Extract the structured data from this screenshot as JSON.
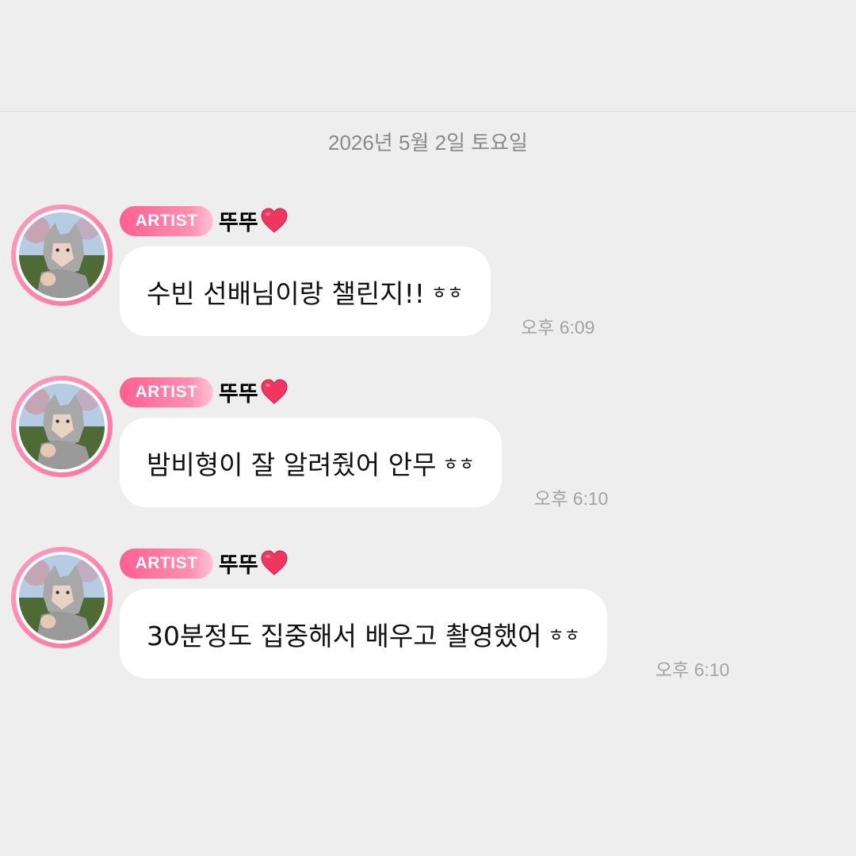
{
  "date_divider": "2026년 5월 2일 토요일",
  "messages": [
    {
      "badge": "ARTIST",
      "sender": "뚜뚜",
      "text": "수빈 선배님이랑 챌린지!!",
      "suffix": "ㅎㅎ",
      "time": "오후 6:09"
    },
    {
      "badge": "ARTIST",
      "sender": "뚜뚜",
      "text": "밤비형이 잘 알려줬어 안무",
      "suffix": "ㅎㅎ",
      "time": "오후 6:10"
    },
    {
      "badge": "ARTIST",
      "sender": "뚜뚜",
      "text": "30분정도 집중해서 배우고 촬영했어",
      "suffix": "ㅎㅎ",
      "time": "오후 6:10"
    }
  ],
  "colors": {
    "background": "#eeeeee",
    "bubble": "#ffffff",
    "badge_start": "#ff5f92",
    "badge_end": "#ffc4d6",
    "heart": "#f0365f",
    "time": "#a3a3a3",
    "date": "#8a8a8a"
  },
  "icons": {
    "name_suffix": "heart-icon",
    "avatar": "profile-avatar-wolf-hood"
  }
}
